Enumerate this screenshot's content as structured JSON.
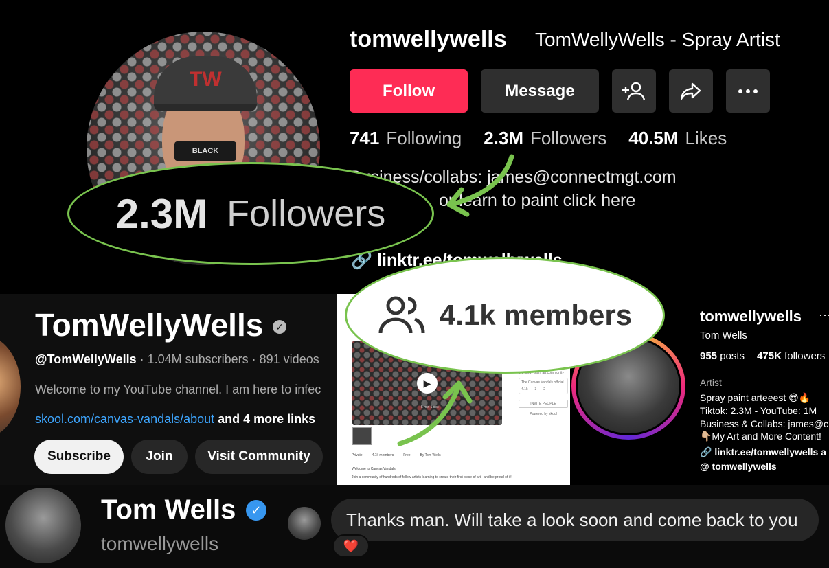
{
  "tiktok": {
    "username": "tomwellywells",
    "nickname": "TomWellyWells - Spray Artist",
    "buttons": {
      "follow": "Follow",
      "message": "Message"
    },
    "stats": [
      {
        "value": "741",
        "label": "Following"
      },
      {
        "value": "2.3M",
        "label": "Followers"
      },
      {
        "value": "40.5M",
        "label": "Likes"
      }
    ],
    "bio_line1": "Business/collabs: james@connectmgt.com",
    "bio_line2": "or learn to paint click here",
    "link": "linktr.ee/tomwellywells",
    "zoom": {
      "value": "2.3M",
      "label": "Followers"
    },
    "avatar_cap_logo": "TW",
    "avatar_can_text": "BLACK"
  },
  "youtube": {
    "channel_name": "TomWellyWells",
    "handle": "@TomWellyWells",
    "meta": " · 1.04M subscribers · 891 videos",
    "description": "Welcome to my YouTube channel. I am here to infec",
    "link": "skool.com/canvas-vandals/about",
    "more_links": " and 4 more links",
    "buttons": {
      "subscribe": "Subscribe",
      "join": "Join",
      "community": "Visit Community"
    }
  },
  "skool": {
    "zoom_members": "4.1k members",
    "side_text": "pro spray paint art community",
    "side_sub": "The Canvas Vandals official",
    "side_counts": [
      "4.1k",
      "3",
      "2"
    ],
    "invite": "INVITE PEOPLE",
    "powered": "Powered by skool",
    "info": [
      "Private",
      "4.1k members",
      "Free",
      "By Tom Wells"
    ],
    "welcome": "Welcome to Canvas Vandals!",
    "join_text": "Join a community of hundreds of fellow artists learning to create their first piece of art - and be proud of it!",
    "video_time": "5 min 1 sec"
  },
  "instagram": {
    "username": "tomwellywells",
    "more": "···",
    "full_name": "Tom Wells",
    "stats": [
      {
        "value": "955",
        "label": "posts"
      },
      {
        "value": "475K",
        "label": "followers"
      }
    ],
    "category": "Artist",
    "bio": [
      "Spray paint arteeest 😎🔥",
      "Tiktok: 2.3M - YouTube: 1M",
      "Business & Collabs: james@c",
      "👇🏼My Art and More Content!"
    ],
    "link": "linktr.ee/tomwellywells a",
    "threads": "tomwellywells"
  },
  "chat": {
    "name": "Tom Wells",
    "handle": "tomwellywells",
    "message": "Thanks man. Will take a look soon and come back to you",
    "reaction": "❤️"
  },
  "colors": {
    "tiktok_follow": "#fe2c55",
    "callout_green": "#79c34e",
    "youtube_link": "#3ea6ff",
    "verified_blue": "#3797f0"
  }
}
